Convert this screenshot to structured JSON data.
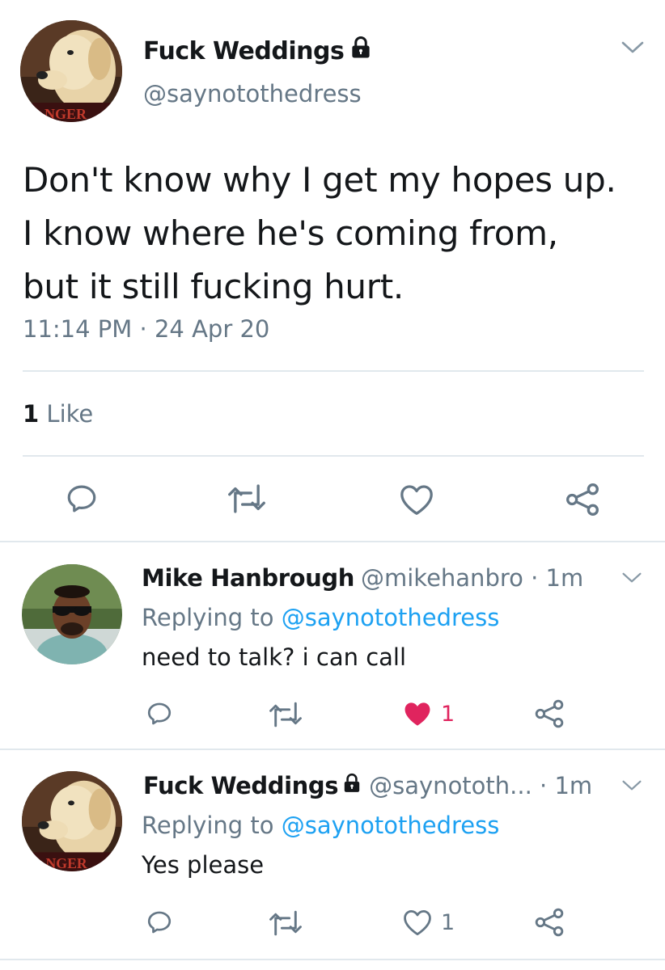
{
  "main_tweet": {
    "display_name": "Fuck Weddings",
    "handle": "@saynotothedress",
    "body_lines": [
      "Don't know why I get my hopes up.",
      "I know where he's coming from,",
      "but it still fucking hurt."
    ],
    "timestamp": "11:14 PM · 24 Apr 20",
    "likes_count": "1",
    "likes_label": "Like"
  },
  "replies": [
    {
      "display_name": "Mike Hanbrough",
      "handle_time": "@mikehanbro · 1m",
      "replying_prefix": "Replying to",
      "replying_to": "@saynotothedress",
      "text": "need to talk? i can call",
      "like_count": "1",
      "liked": true
    },
    {
      "display_name": "Fuck Weddings",
      "handle_time": "@saynototh... · 1m",
      "replying_prefix": "Replying to",
      "replying_to": "@saynotothedress",
      "text": "Yes please",
      "like_count": "1",
      "liked": false
    }
  ],
  "avatar_text": "NGER",
  "icons": [
    "chevron-down-icon",
    "lock-icon",
    "reply-icon",
    "retweet-icon",
    "heart-icon",
    "share-icon"
  ],
  "colors": {
    "text": "#14171a",
    "secondary": "#657786",
    "link": "#1da1f2",
    "liked": "#e0245e",
    "divider": "#e1e8ed"
  }
}
